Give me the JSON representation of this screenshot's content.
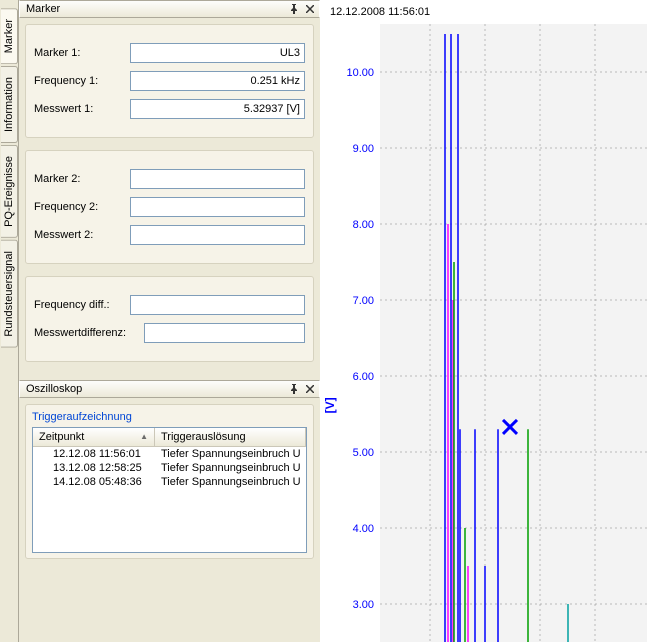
{
  "tabs": {
    "marker": "Marker",
    "information": "Information",
    "pq": "PQ-Ereignisse",
    "rund": "Rundsteuersignal"
  },
  "panels": {
    "marker_title": "Marker",
    "osz_title": "Oszilloskop"
  },
  "marker": {
    "g1": {
      "marker_label": "Marker 1:",
      "marker_val": "UL3",
      "freq_label": "Frequency 1:",
      "freq_val": "0.251 kHz",
      "mess_label": "Messwert 1:",
      "mess_val": "5.32937 [V]"
    },
    "g2": {
      "marker_label": "Marker 2:",
      "marker_val": "",
      "freq_label": "Frequency 2:",
      "freq_val": "",
      "mess_label": "Messwert 2:",
      "mess_val": ""
    },
    "g3": {
      "fd_label": "Frequency diff.:",
      "fd_val": "",
      "md_label": "Messwertdifferenz:",
      "md_val": ""
    }
  },
  "osz": {
    "trigger_title": "Triggeraufzeichnung",
    "col_a": "Zeitpunkt",
    "col_b": "Triggerauslösung",
    "rows": [
      {
        "a": "12.12.08 11:56:01",
        "b": "Tiefer Spannungseinbruch U"
      },
      {
        "a": "13.12.08 12:58:25",
        "b": "Tiefer Spannungseinbruch U"
      },
      {
        "a": "14.12.08 05:48:36",
        "b": "Tiefer Spannungseinbruch U"
      }
    ]
  },
  "chart": {
    "timestamp": "12.12.2008 11:56:01",
    "y_unit": "[V]"
  },
  "chart_data": {
    "type": "bar",
    "ylabel": "[V]",
    "ylim": [
      2.5,
      10.5
    ],
    "yticks": [
      3.0,
      4.0,
      5.0,
      6.0,
      7.0,
      8.0,
      9.0,
      10.0
    ],
    "marker": {
      "x": 130,
      "y": 5.33,
      "color": "#0000ff"
    },
    "bars": [
      {
        "x": 65,
        "h": 10.5,
        "color": "#0000ff"
      },
      {
        "x": 68,
        "h": 8.0,
        "color": "#ff00ff"
      },
      {
        "x": 71,
        "h": 10.5,
        "color": "#0000ff"
      },
      {
        "x": 73,
        "h": 7.0,
        "color": "#ff00ff"
      },
      {
        "x": 74,
        "h": 7.5,
        "color": "#00a000"
      },
      {
        "x": 78,
        "h": 10.5,
        "color": "#0000ff"
      },
      {
        "x": 80,
        "h": 5.3,
        "color": "#0000ff"
      },
      {
        "x": 85,
        "h": 4.0,
        "color": "#00a000"
      },
      {
        "x": 88,
        "h": 3.5,
        "color": "#ff00ff"
      },
      {
        "x": 95,
        "h": 5.3,
        "color": "#0000ff"
      },
      {
        "x": 105,
        "h": 3.5,
        "color": "#0000ff"
      },
      {
        "x": 118,
        "h": 5.3,
        "color": "#0000ff"
      },
      {
        "x": 148,
        "h": 5.3,
        "color": "#00a000"
      },
      {
        "x": 188,
        "h": 3.0,
        "color": "#00a0a0"
      }
    ]
  }
}
